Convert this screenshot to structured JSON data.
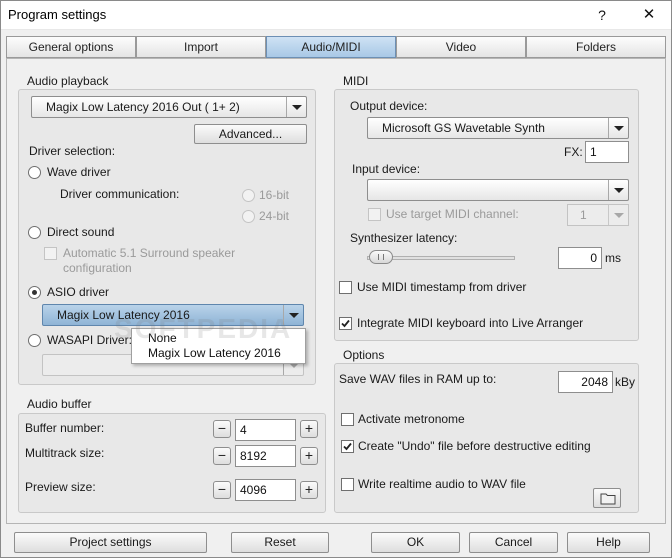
{
  "window": {
    "title": "Program settings",
    "help_glyph": "?",
    "close_glyph": "✕"
  },
  "tabs": [
    {
      "label": "General options",
      "active": false
    },
    {
      "label": "Import",
      "active": false
    },
    {
      "label": "Audio/MIDI",
      "active": true
    },
    {
      "label": "Video",
      "active": false
    },
    {
      "label": "Folders",
      "active": false
    }
  ],
  "audio_playback": {
    "label": "Audio playback",
    "device": "Magix Low Latency 2016 Out ( 1+ 2)",
    "advanced_label": "Advanced...",
    "driver_selection_label": "Driver selection:",
    "wave_driver": "Wave driver",
    "driver_communication": "Driver communication:",
    "bit16": "16-bit",
    "bit24": "24-bit",
    "direct_sound": "Direct sound",
    "surround_line1": "Automatic 5.1 Surround speaker",
    "surround_line2": "configuration",
    "asio_driver": "ASIO driver",
    "asio_selected": "Magix Low Latency 2016",
    "asio_options": [
      "None",
      "Magix Low Latency 2016"
    ],
    "wasapi_driver": "WASAPI Driver:"
  },
  "audio_buffer": {
    "label": "Audio buffer",
    "buffer_number_label": "Buffer number:",
    "buffer_number": "4",
    "multitrack_label": "Multitrack size:",
    "multitrack": "8192",
    "preview_label": "Preview size:",
    "preview": "4096",
    "minus": "−",
    "plus": "+"
  },
  "midi": {
    "label": "MIDI",
    "output_label": "Output device:",
    "output_device": "Microsoft GS Wavetable Synth",
    "fx_label": "FX:",
    "fx_value": "1",
    "input_label": "Input device:",
    "input_device": "",
    "target_channel_label": "Use target MIDI channel:",
    "target_channel": "1",
    "synth_latency_label": "Synthesizer latency:",
    "synth_latency": "0",
    "synth_latency_unit": "ms",
    "slider_fraction": 0.0,
    "timestamp_label": "Use MIDI timestamp from driver",
    "timestamp_checked": false,
    "integrate_label": "Integrate MIDI keyboard into Live Arranger",
    "integrate_checked": true
  },
  "options": {
    "label": "Options",
    "save_wav_label": "Save WAV files in RAM up to:",
    "save_wav_value": "2048",
    "save_wav_unit": "kBy",
    "metronome_label": "Activate metronome",
    "metronome_checked": false,
    "undo_label": "Create \"Undo\" file before destructive editing",
    "undo_checked": true,
    "realtime_label": "Write realtime audio to WAV file",
    "realtime_checked": false
  },
  "footer": {
    "project_settings": "Project settings",
    "reset": "Reset",
    "ok": "OK",
    "cancel": "Cancel",
    "help": "Help"
  },
  "watermark": "SOFTPEDIA",
  "colors": {
    "active_tab": "#a8c8e6",
    "selected_combo": "#8fb4d6"
  }
}
